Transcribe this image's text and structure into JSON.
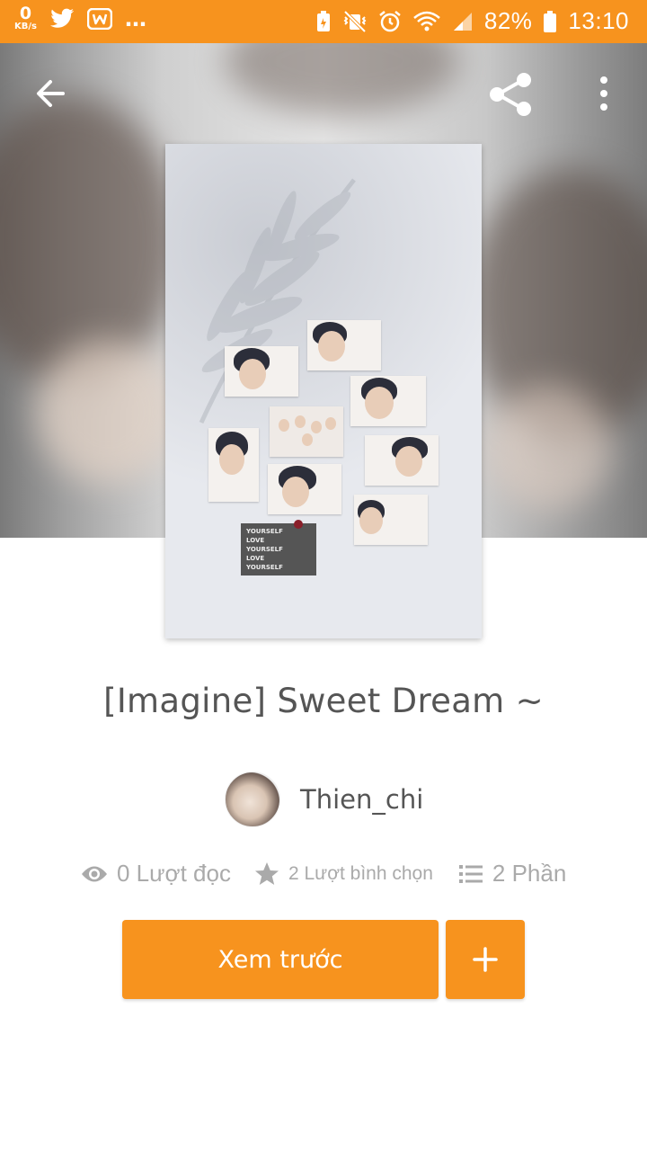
{
  "status_bar": {
    "net_speed": "0",
    "net_unit": "KB/s",
    "more": "…",
    "battery": "82%",
    "time": "13:10"
  },
  "header": {
    "back_icon": "arrow-left-icon",
    "share_icon": "share-icon",
    "more_icon": "more-vertical-icon"
  },
  "cover": {
    "note_lines": [
      "YOURSELF",
      "LOVE",
      "YOURSELF",
      "LOVE",
      "YOURSELF"
    ]
  },
  "story": {
    "title": "[Imagine] Sweet Dream ~",
    "author": "Thien_chi",
    "reads": "0 Lượt đọc",
    "votes": "2 Lượt bình chọn",
    "parts": "2 Phần"
  },
  "actions": {
    "preview_label": "Xem trước",
    "add_icon": "plus-icon"
  },
  "colors": {
    "accent": "#f7931e",
    "text": "#555555",
    "muted": "#aaaaaa"
  }
}
